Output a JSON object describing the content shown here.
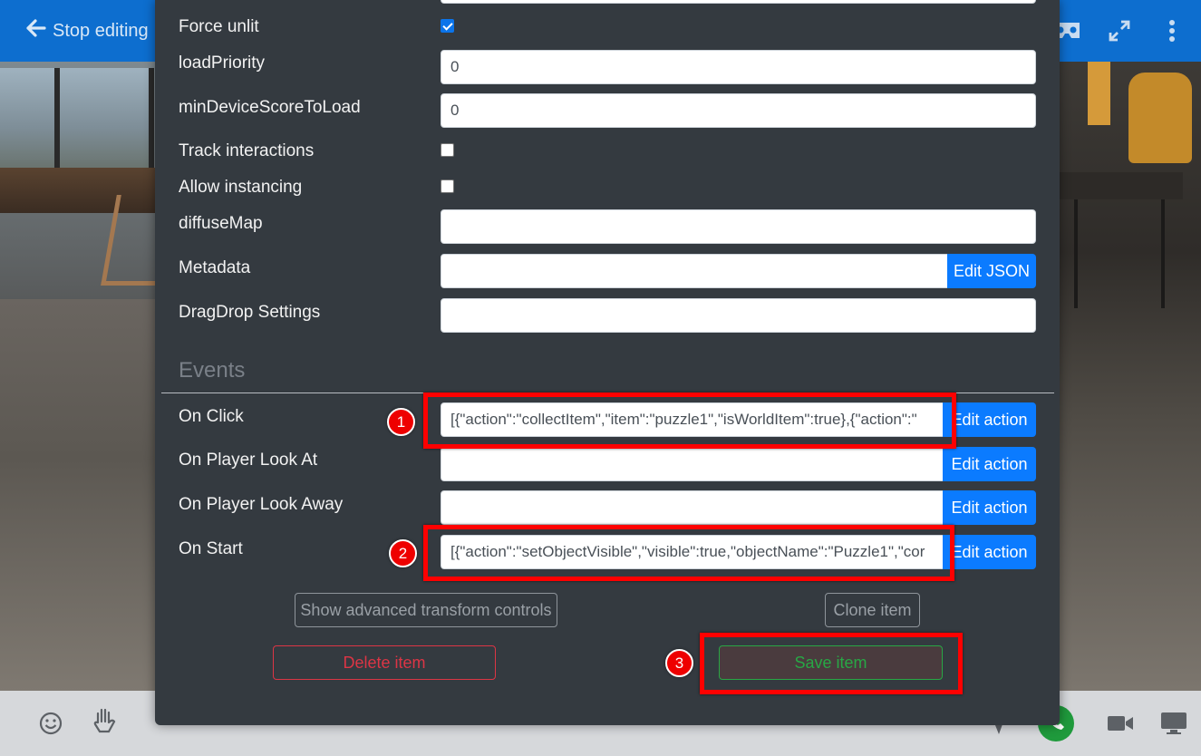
{
  "topbar": {
    "stop_editing_label": "Stop editing"
  },
  "properties": {
    "force_unlit": {
      "label": "Force unlit",
      "checked": true
    },
    "load_priority": {
      "label": "loadPriority",
      "value": "0"
    },
    "min_device_score": {
      "label": "minDeviceScoreToLoad",
      "value": "0"
    },
    "track_interactions": {
      "label": "Track interactions",
      "checked": false
    },
    "allow_instancing": {
      "label": "Allow instancing",
      "checked": false
    },
    "diffuse_map": {
      "label": "diffuseMap",
      "value": ""
    },
    "metadata": {
      "label": "Metadata",
      "value": "",
      "button": "Edit JSON"
    },
    "dragdrop": {
      "label": "DragDrop Settings",
      "value": ""
    }
  },
  "events": {
    "title": "Events",
    "on_click": {
      "label": "On Click",
      "value": "[{\"action\":\"collectItem\",\"item\":\"puzzle1\",\"isWorldItem\":true},{\"action\":\"",
      "button": "Edit action"
    },
    "on_look_at": {
      "label": "On Player Look At",
      "value": "",
      "button": "Edit action"
    },
    "on_look_away": {
      "label": "On Player Look Away",
      "value": "",
      "button": "Edit action"
    },
    "on_start": {
      "label": "On Start",
      "value": "[{\"action\":\"setObjectVisible\",\"visible\":true,\"objectName\":\"Puzzle1\",\"cor",
      "button": "Edit action"
    }
  },
  "actions": {
    "advanced_transform": "Show advanced transform controls",
    "clone": "Clone item",
    "delete": "Delete item",
    "save": "Save item"
  },
  "annotations": {
    "badge1": "1",
    "badge2": "2",
    "badge3": "3"
  },
  "colors": {
    "primary": "#0b7bff",
    "danger": "#dc3545",
    "success": "#28a745",
    "highlight": "#ff0000",
    "modal_bg": "#343a40"
  }
}
